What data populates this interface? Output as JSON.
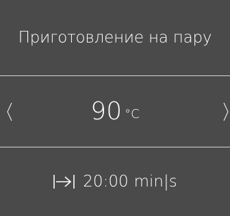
{
  "program": {
    "title": "Приготовление на пару"
  },
  "temperature": {
    "value": "90",
    "unit": "°C"
  },
  "duration": {
    "icon": "duration-arrow-icon",
    "value": "20:00",
    "unit": "min|s"
  },
  "colors": {
    "background": "#4a4a4a",
    "text": "#ffffff",
    "divider": "#d8d8d8"
  }
}
